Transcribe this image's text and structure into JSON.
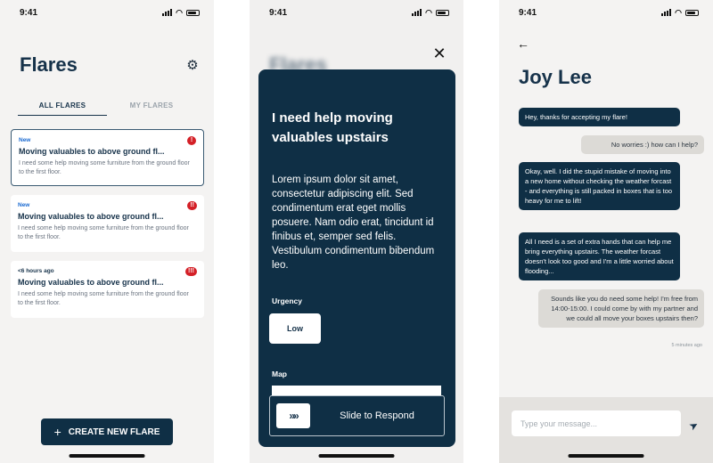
{
  "status_time": "9:41",
  "flares_screen": {
    "title": "Flares",
    "tabs": [
      "ALL FLARES",
      "MY FLARES"
    ],
    "cards": [
      {
        "meta": "New",
        "title": "Moving valuables to above ground fl...",
        "desc": "I need some help moving some furniture from the ground floor to the first floor.",
        "badge": "!"
      },
      {
        "meta": "New",
        "title": "Moving valuables to above ground fl...",
        "desc": "I need some help moving some furniture from the ground floor to the first floor.",
        "badge": "!!"
      },
      {
        "meta": "<6 hours ago",
        "title": "Moving valuables to above ground fl...",
        "desc": "I need some help moving some furniture from the ground floor to the first floor.",
        "badge": "!!!"
      }
    ],
    "create_button": "CREATE NEW FLARE"
  },
  "detail_screen": {
    "bg_title": "Flares",
    "title": "I need help moving valuables upstairs",
    "body": "Lorem ipsum dolor sit amet, consectetur adipiscing elit. Sed condimentum erat eget mollis posuere. Nam odio erat, tincidunt id finibus et, semper sed felis. Vestibulum condimentum bibendum leo.",
    "urgency_label": "Urgency",
    "urgency_value": "Low",
    "map_label": "Map",
    "slider_handle": "»»",
    "slider_label": "Slide to Respond"
  },
  "chat_screen": {
    "title": "Joy Lee",
    "messages": [
      {
        "from": "them",
        "text": "Hey, thanks for accepting my flare!"
      },
      {
        "from": "me",
        "text": "No worries :)  how can I help?"
      },
      {
        "from": "them",
        "text": "Okay, well. I did the stupid mistake of moving into a new home without checking the weather forcast - and everything is still packed in boxes that is too heavy for me to lift!"
      },
      {
        "from": "them",
        "text": "All I need is a set of extra hands that can help me bring everything upstairs. The weather forcast doesn't look too good and I'm a little worried about flooding..."
      },
      {
        "from": "me",
        "text": "Sounds like you do need some help! I'm free from 14:00-15:00. I could come by with my partner and we could all move your boxes upstairs then?"
      }
    ],
    "timestamp": "5 minutes ago",
    "input_placeholder": "Type your message..."
  },
  "colors": {
    "navy": "#0f2f45",
    "alert_red": "#d42027",
    "new_blue": "#1a6ad1"
  }
}
